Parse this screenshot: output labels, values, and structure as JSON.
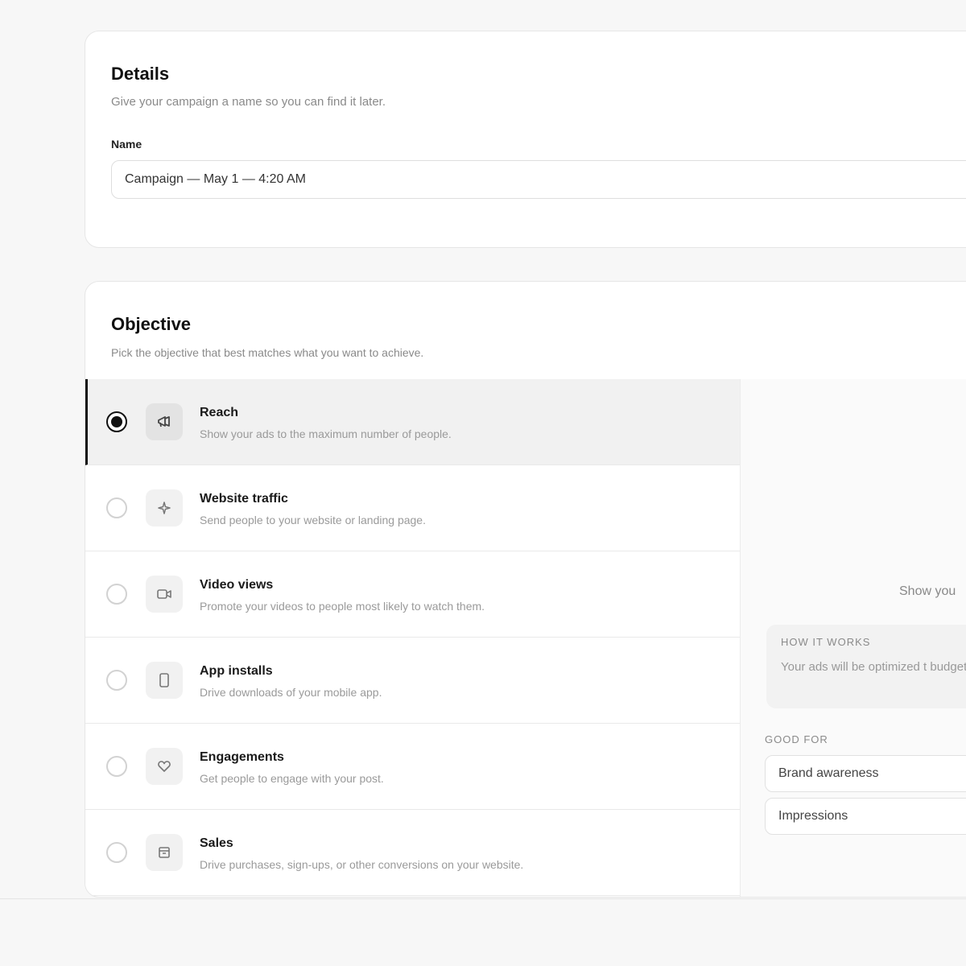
{
  "details": {
    "title": "Details",
    "subtitle": "Give your campaign a name so you can find it later.",
    "name_label": "Name",
    "name_value": "Campaign — May 1 — 4:20 AM"
  },
  "objective": {
    "title": "Objective",
    "subtitle": "Pick the objective that best matches what you want to achieve.",
    "selected": "Reach",
    "options": [
      {
        "title": "Reach",
        "description": "Show your ads to the maximum number of people.",
        "icon": "megaphone-icon"
      },
      {
        "title": "Website traffic",
        "description": "Send people to your website or landing page.",
        "icon": "sparkle-icon"
      },
      {
        "title": "Video views",
        "description": "Promote your videos to people most likely to watch them.",
        "icon": "video-camera-icon"
      },
      {
        "title": "App installs",
        "description": "Drive downloads of your mobile app.",
        "icon": "phone-icon"
      },
      {
        "title": "Engagements",
        "description": "Get people to engage with your post.",
        "icon": "heart-icon"
      },
      {
        "title": "Sales",
        "description": "Drive purchases, sign-ups, or other conversions on your website.",
        "icon": "storefront-icon"
      }
    ],
    "preview": {
      "description": "Show you",
      "how_label": "HOW IT WORKS",
      "how_text": "Your ads will be optimized t budget.",
      "good_for_label": "GOOD FOR",
      "good_for": [
        "Brand awareness",
        "Impressions"
      ]
    }
  }
}
